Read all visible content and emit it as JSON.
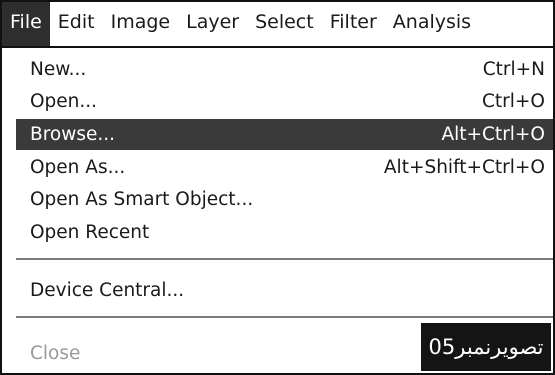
{
  "menubar": {
    "items": [
      {
        "label": "File"
      },
      {
        "label": "Edit"
      },
      {
        "label": "Image"
      },
      {
        "label": "Layer"
      },
      {
        "label": "Select"
      },
      {
        "label": "Filter"
      },
      {
        "label": "Analysis"
      }
    ]
  },
  "file_menu": {
    "items": [
      {
        "label": "New...",
        "shortcut": "Ctrl+N"
      },
      {
        "label": "Open...",
        "shortcut": "Ctrl+O"
      },
      {
        "label": "Browse...",
        "shortcut": "Alt+Ctrl+O"
      },
      {
        "label": "Open As...",
        "shortcut": "Alt+Shift+Ctrl+O"
      },
      {
        "label": "Open As Smart Object..."
      },
      {
        "label": "Open Recent"
      },
      {
        "label": "Device Central..."
      },
      {
        "label": "Close"
      }
    ]
  },
  "caption": {
    "text": "تصویرنمبر05"
  }
}
